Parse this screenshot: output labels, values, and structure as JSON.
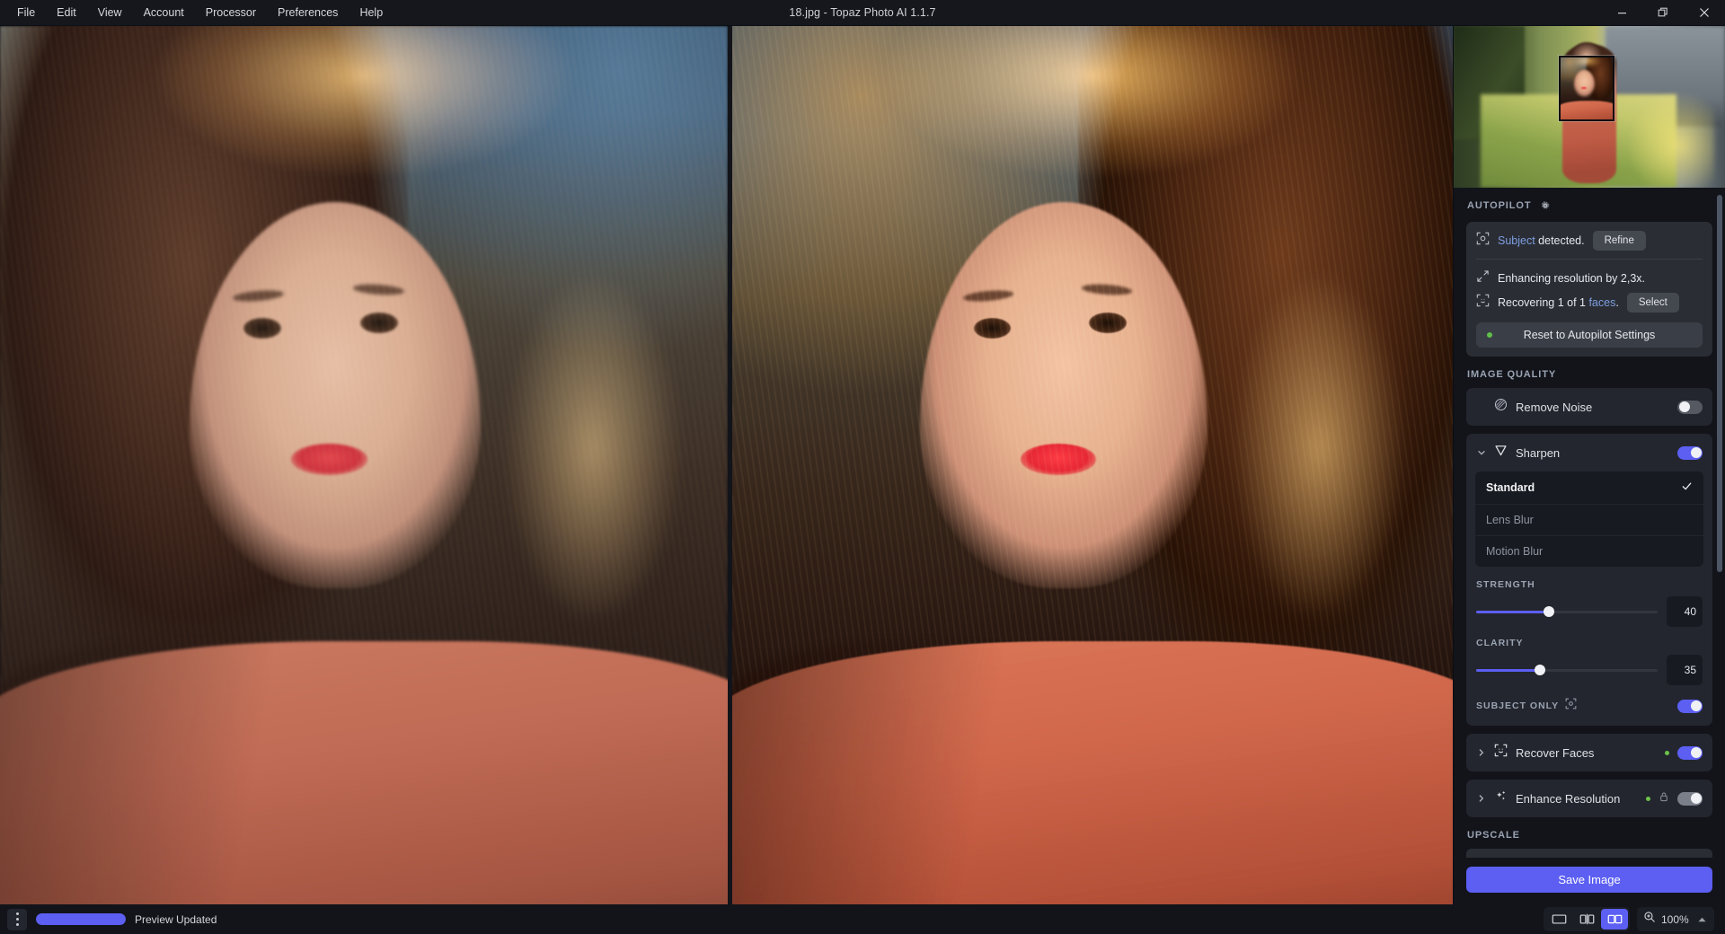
{
  "window": {
    "title": "18.jpg - Topaz Photo AI 1.1.7",
    "minimize_label": "minimize-icon",
    "restore_label": "restore-icon",
    "close_label": "close-icon"
  },
  "menu": {
    "items": [
      {
        "label": "File"
      },
      {
        "label": "Edit"
      },
      {
        "label": "View"
      },
      {
        "label": "Account"
      },
      {
        "label": "Processor"
      },
      {
        "label": "Preferences"
      },
      {
        "label": "Help"
      }
    ]
  },
  "autopilot": {
    "section_title": "AUTOPILOT",
    "subject_prefix": "Subject",
    "subject_suffix": " detected.",
    "refine_label": "Refine",
    "resolution_text": "Enhancing resolution by 2,3x.",
    "faces_prefix": "Recovering 1 of 1 ",
    "faces_link": "faces",
    "faces_suffix": ".",
    "select_label": "Select",
    "reset_label": "Reset to Autopilot Settings"
  },
  "image_quality": {
    "section_title": "IMAGE QUALITY",
    "remove_noise": {
      "label": "Remove Noise",
      "enabled": false
    },
    "sharpen": {
      "label": "Sharpen",
      "enabled": true,
      "expanded": true,
      "modes": [
        {
          "label": "Standard",
          "selected": true
        },
        {
          "label": "Lens Blur",
          "selected": false
        },
        {
          "label": "Motion Blur",
          "selected": false
        }
      ],
      "strength": {
        "label": "STRENGTH",
        "value": 40,
        "percent": 40
      },
      "clarity": {
        "label": "CLARITY",
        "value": 35,
        "percent": 35
      },
      "subject_only": {
        "label": "SUBJECT ONLY",
        "enabled": true
      }
    },
    "recover_faces": {
      "label": "Recover Faces",
      "enabled": true,
      "has_dot": true
    },
    "enhance_resolution": {
      "label": "Enhance Resolution",
      "enabled": true,
      "locked": true,
      "has_dot": true
    }
  },
  "upscale": {
    "section_title": "UPSCALE"
  },
  "actions": {
    "save_label": "Save Image"
  },
  "statusbar": {
    "status_text": "Preview Updated",
    "progress_percent": 100,
    "zoom_level": "100%",
    "view_modes": [
      {
        "name": "single-view",
        "active": false
      },
      {
        "name": "split-view",
        "active": false
      },
      {
        "name": "side-by-side-view",
        "active": true
      }
    ]
  },
  "colors": {
    "accent": "#5c5ff2",
    "link": "#7e9fe0",
    "panel_bg": "#12141a",
    "card_bg": "#2a2d34",
    "status_green": "#6cc24a"
  }
}
